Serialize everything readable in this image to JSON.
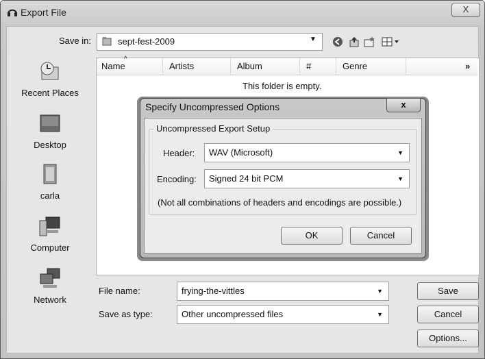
{
  "window": {
    "title": "Export File",
    "close_glyph": "X"
  },
  "save_in": {
    "label": "Save in:",
    "value": "sept-fest-2009"
  },
  "toolbar": {
    "icons": [
      "back-icon",
      "up-folder-icon",
      "new-folder-icon",
      "views-menu-icon"
    ]
  },
  "places": [
    {
      "name": "places-recent",
      "label": "Recent Places",
      "icon": "recent-places-icon"
    },
    {
      "name": "places-desktop",
      "label": "Desktop",
      "icon": "desktop-icon"
    },
    {
      "name": "places-user",
      "label": "carla",
      "icon": "user-folder-icon"
    },
    {
      "name": "places-computer",
      "label": "Computer",
      "icon": "computer-icon"
    },
    {
      "name": "places-network",
      "label": "Network",
      "icon": "network-icon"
    }
  ],
  "file_list": {
    "columns": [
      "Name",
      "Artists",
      "Album",
      "#",
      "Genre"
    ],
    "more": "»",
    "empty_message": "This folder is empty."
  },
  "file_name": {
    "label": "File name:",
    "value": "frying-the-vittles"
  },
  "save_type": {
    "label": "Save as type:",
    "value": "Other uncompressed files"
  },
  "buttons": {
    "save": "Save",
    "cancel": "Cancel",
    "options": "Options..."
  },
  "dialog": {
    "title": "Specify Uncompressed Options",
    "close_glyph": "x",
    "group_title": "Uncompressed Export Setup",
    "header_label": "Header:",
    "header_value": "WAV (Microsoft)",
    "encoding_label": "Encoding:",
    "encoding_value": "Signed 24 bit PCM",
    "note": "(Not all combinations of headers and encodings are possible.)",
    "ok": "OK",
    "cancel": "Cancel"
  }
}
